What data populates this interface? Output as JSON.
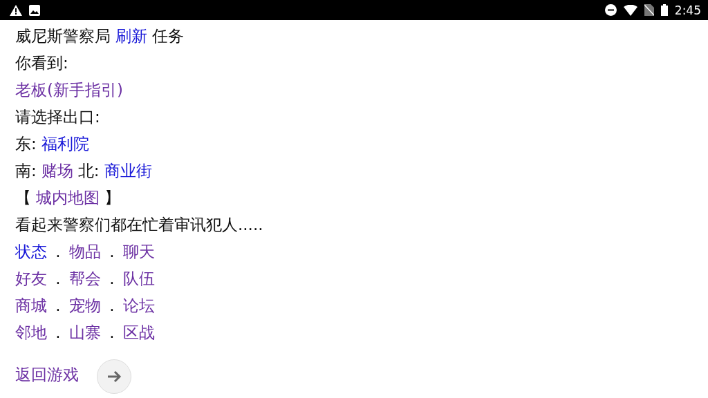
{
  "status_bar": {
    "time": "2:45"
  },
  "lines": [
    {
      "parts": [
        {
          "kind": "text",
          "text": "威尼斯警察局"
        },
        {
          "kind": "link",
          "text": "刷新",
          "visited": false
        },
        {
          "kind": "text",
          "text": "任务"
        }
      ]
    },
    {
      "parts": [
        {
          "kind": "text",
          "text": "你看到:"
        }
      ]
    },
    {
      "parts": [
        {
          "kind": "link",
          "text": "老板(新手指引)",
          "visited": true
        }
      ]
    },
    {
      "parts": [
        {
          "kind": "text",
          "text": "请选择出口:"
        }
      ]
    },
    {
      "parts": [
        {
          "kind": "text",
          "text": "东:"
        },
        {
          "kind": "link",
          "text": "福利院",
          "visited": false
        }
      ]
    },
    {
      "parts": [
        {
          "kind": "text",
          "text": "南:"
        },
        {
          "kind": "link",
          "text": "赌场",
          "visited": true
        },
        {
          "kind": "text",
          "text": "北:"
        },
        {
          "kind": "link",
          "text": "商业街",
          "visited": false
        }
      ]
    },
    {
      "parts": [
        {
          "kind": "text",
          "text": "【"
        },
        {
          "kind": "link",
          "text": "城内地图",
          "visited": true
        },
        {
          "kind": "text",
          "text": "】"
        }
      ]
    },
    {
      "parts": [
        {
          "kind": "text",
          "text": "看起来警察们都在忙着审讯犯人....."
        }
      ]
    },
    {
      "parts": [
        {
          "kind": "link",
          "text": "状态",
          "visited": false
        },
        {
          "kind": "separator",
          "text": "."
        },
        {
          "kind": "link",
          "text": "物品",
          "visited": true
        },
        {
          "kind": "separator",
          "text": "."
        },
        {
          "kind": "link",
          "text": "聊天",
          "visited": true
        }
      ]
    },
    {
      "parts": [
        {
          "kind": "link",
          "text": "好友",
          "visited": true
        },
        {
          "kind": "separator",
          "text": "."
        },
        {
          "kind": "link",
          "text": "帮会",
          "visited": true
        },
        {
          "kind": "separator",
          "text": "."
        },
        {
          "kind": "link",
          "text": "队伍",
          "visited": true
        }
      ]
    },
    {
      "parts": [
        {
          "kind": "link",
          "text": "商城",
          "visited": true
        },
        {
          "kind": "separator",
          "text": "."
        },
        {
          "kind": "link",
          "text": "宠物",
          "visited": true
        },
        {
          "kind": "separator",
          "text": "."
        },
        {
          "kind": "link",
          "text": "论坛",
          "visited": true
        }
      ]
    },
    {
      "parts": [
        {
          "kind": "link",
          "text": "邻地",
          "visited": true
        },
        {
          "kind": "separator",
          "text": "."
        },
        {
          "kind": "link",
          "text": "山寨",
          "visited": true
        },
        {
          "kind": "separator",
          "text": "."
        },
        {
          "kind": "link",
          "text": "区战",
          "visited": true
        }
      ]
    }
  ],
  "footer_link": {
    "text": "返回游戏",
    "visited": true
  }
}
